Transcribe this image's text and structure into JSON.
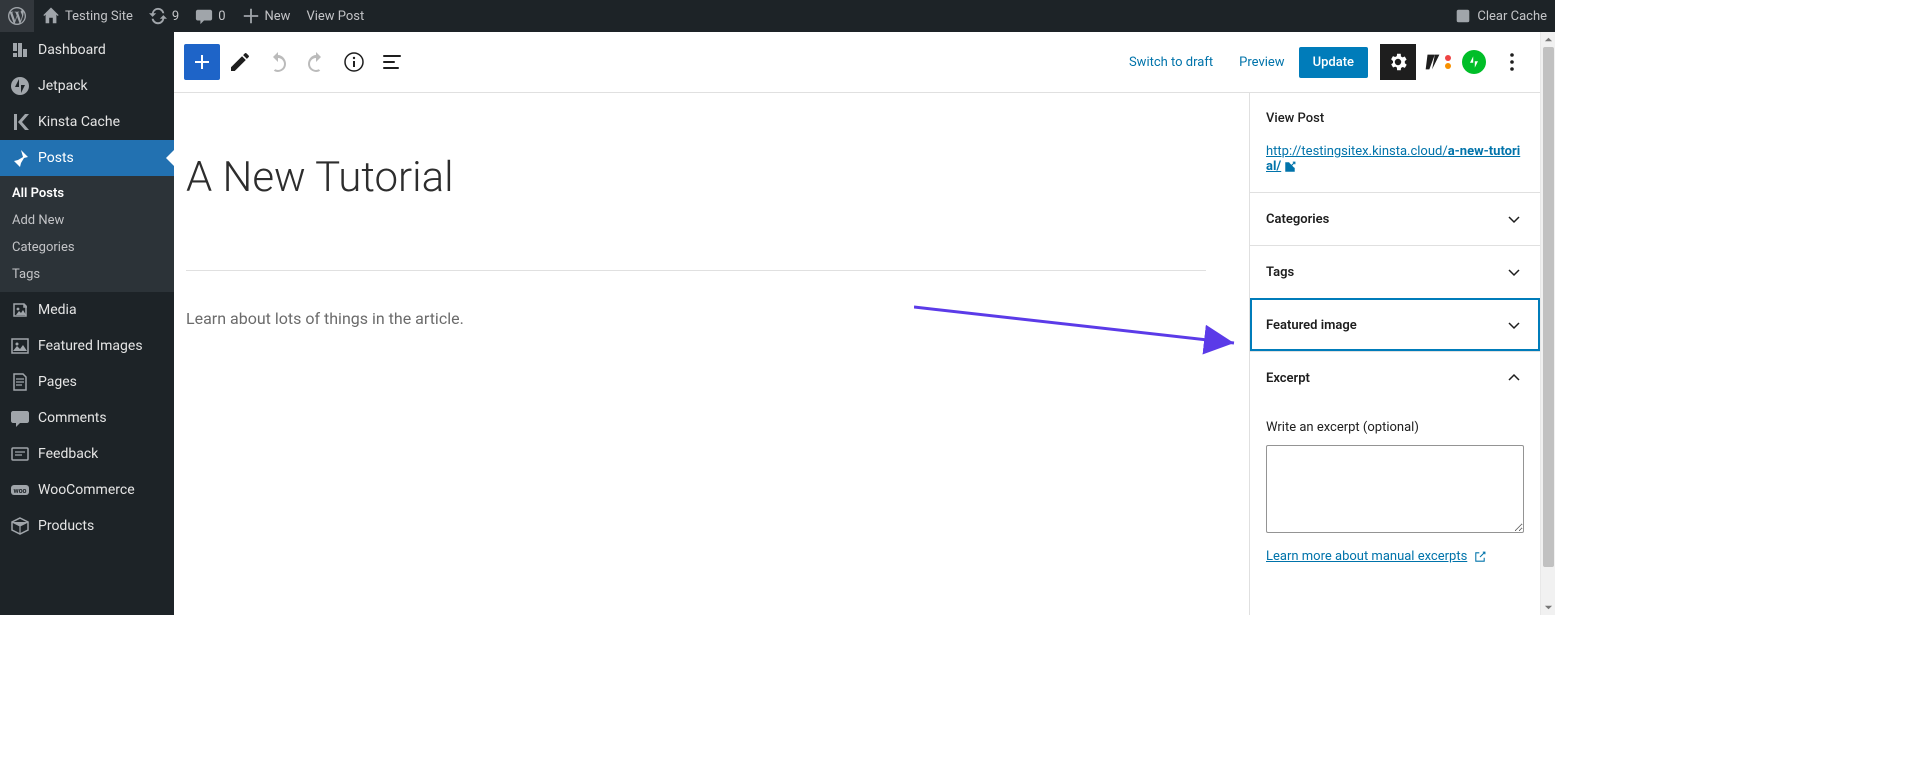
{
  "adminbar": {
    "site_name": "Testing Site",
    "updates_count": "9",
    "comments_count": "0",
    "new_label": "New",
    "view_post_label": "View Post",
    "clear_cache_label": "Clear Cache"
  },
  "admin_menu": {
    "dashboard": "Dashboard",
    "jetpack": "Jetpack",
    "kinsta_cache": "Kinsta Cache",
    "posts": "Posts",
    "posts_sub": {
      "all_posts": "All Posts",
      "add_new": "Add New",
      "categories": "Categories",
      "tags": "Tags"
    },
    "media": "Media",
    "featured_images": "Featured Images",
    "pages": "Pages",
    "comments": "Comments",
    "feedback": "Feedback",
    "woocommerce": "WooCommerce",
    "products": "Products"
  },
  "toolbar": {
    "switch_to_draft": "Switch to draft",
    "preview": "Preview",
    "update": "Update"
  },
  "post": {
    "title": "A New Tutorial",
    "content": "Learn about lots of things in the article."
  },
  "settings": {
    "view_post_label": "View Post",
    "permalink_base": "http://testingsitex.kinsta.cloud/",
    "permalink_slug": "a-new-tutorial/",
    "categories": "Categories",
    "tags": "Tags",
    "featured_image": "Featured image",
    "excerpt": "Excerpt",
    "excerpt_label": "Write an excerpt (optional)",
    "excerpt_learn_more": "Learn more about manual excerpts"
  }
}
